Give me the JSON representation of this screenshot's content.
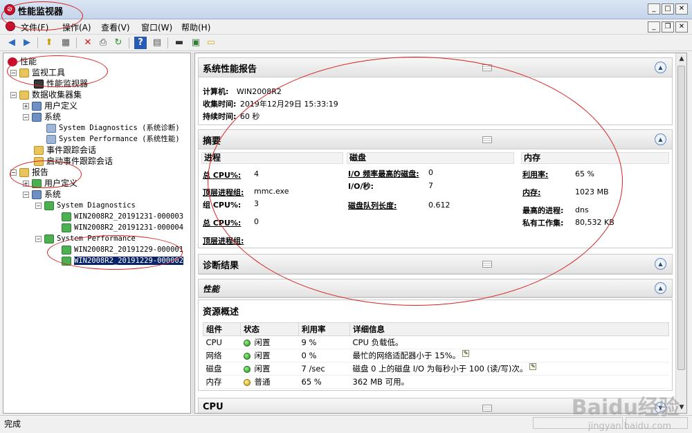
{
  "window": {
    "title": "性能监视器"
  },
  "menu": {
    "items": [
      {
        "label": "文件(F)"
      },
      {
        "label": "操作(A)"
      },
      {
        "label": "查看(V)"
      },
      {
        "label": "窗口(W)"
      },
      {
        "label": "帮助(H)"
      }
    ]
  },
  "toolbar": {
    "icons": [
      "back-icon",
      "forward-icon",
      "up-icon",
      "show-hide-tree-icon",
      "delete-icon",
      "print-icon",
      "refresh-icon",
      "help-icon",
      "properties-icon",
      "monitor-icon",
      "new-report-icon",
      "folder-icon"
    ]
  },
  "tree": {
    "root": "性能",
    "monitoring_tools": "监视工具",
    "perf_monitor": "性能监视器",
    "data_collector_sets": "数据收集器集",
    "user_defined": "用户定义",
    "system": "系统",
    "sys_diag": "System Diagnostics (系统诊断)",
    "sys_perf": "System Performance (系统性能)",
    "event_trace": "事件跟踪会话",
    "startup_trace": "启动事件跟踪会话",
    "reports": "报告",
    "reports_user_defined": "用户定义",
    "reports_system": "系统",
    "reports_sys_diag": "System Diagnostics",
    "diag_report_1": "WIN2008R2_20191231-000003",
    "diag_report_2": "WIN2008R2_20191231-000004",
    "reports_sys_perf": "System Performance",
    "perf_report_1": "WIN2008R2_20191229-000001",
    "perf_report_2": "WIN2008R2_20191229-000002"
  },
  "report": {
    "header": {
      "title": "系统性能报告",
      "computer_label": "计算机:",
      "computer_value": "WIN2008R2",
      "collected_label": "收集时间:",
      "collected_value": "2019年12月29日  15:33:19",
      "duration_label": "持续时间:",
      "duration_value": "60 秒"
    },
    "summary": {
      "title": "摘要",
      "process": {
        "heading": "进程",
        "total_cpu_label": "总 CPU%:",
        "total_cpu_value": "4",
        "top_group_label": "顶层进程组:",
        "top_group_value": "mmc.exe",
        "group_cpu_label": "组 CPU%:",
        "group_cpu_value": "3",
        "total_cpu2_label": "总 CPU%:",
        "total_cpu2_value": "0",
        "top_group2_label": "顶层进程组:"
      },
      "disk": {
        "heading": "磁盘",
        "highest_io_label": "I/O 频率最高的磁盘:",
        "highest_io_value": "0",
        "io_per_sec_label": "I/O/秒:",
        "io_per_sec_value": "7",
        "queue_label": "磁盘队列长度:",
        "queue_value": "0.612"
      },
      "memory": {
        "heading": "内存",
        "util_label": "利用率:",
        "util_value": "65 %",
        "mem_label": "内存:",
        "mem_value": "1023 MB",
        "top_proc_label": "最高的进程:",
        "top_proc_value": "dns",
        "private_ws_label": "私有工作集:",
        "private_ws_value": "80,532 KB"
      }
    },
    "diagnostics": {
      "title": "诊断结果"
    },
    "performance": {
      "title": "性能"
    },
    "resource_overview": {
      "title": "资源概述",
      "columns": [
        "组件",
        "状态",
        "利用率",
        "详细信息"
      ],
      "rows": [
        {
          "component": "CPU",
          "status": "闲置",
          "status_color": "green",
          "util": "9 %",
          "detail": "CPU 负载低。",
          "note": false
        },
        {
          "component": "网络",
          "status": "闲置",
          "status_color": "green",
          "util": "0 %",
          "detail": "最忙的网络适配器小于 15%。",
          "note": true
        },
        {
          "component": "磁盘",
          "status": "闲置",
          "status_color": "green",
          "util": "7 /sec",
          "detail": "磁盘 0 上的磁盘 I/O 为每秒小于 100 (读/写)次。",
          "note": true
        },
        {
          "component": "内存",
          "status": "普通",
          "status_color": "yellow",
          "util": "65 %",
          "detail": "362 MB 可用。",
          "note": false
        }
      ]
    },
    "cpu": {
      "title": "CPU"
    }
  },
  "status_bar": {
    "text": "完成"
  },
  "watermark": {
    "brand": "Baidu经验",
    "url": "jingyan.baidu.com"
  }
}
